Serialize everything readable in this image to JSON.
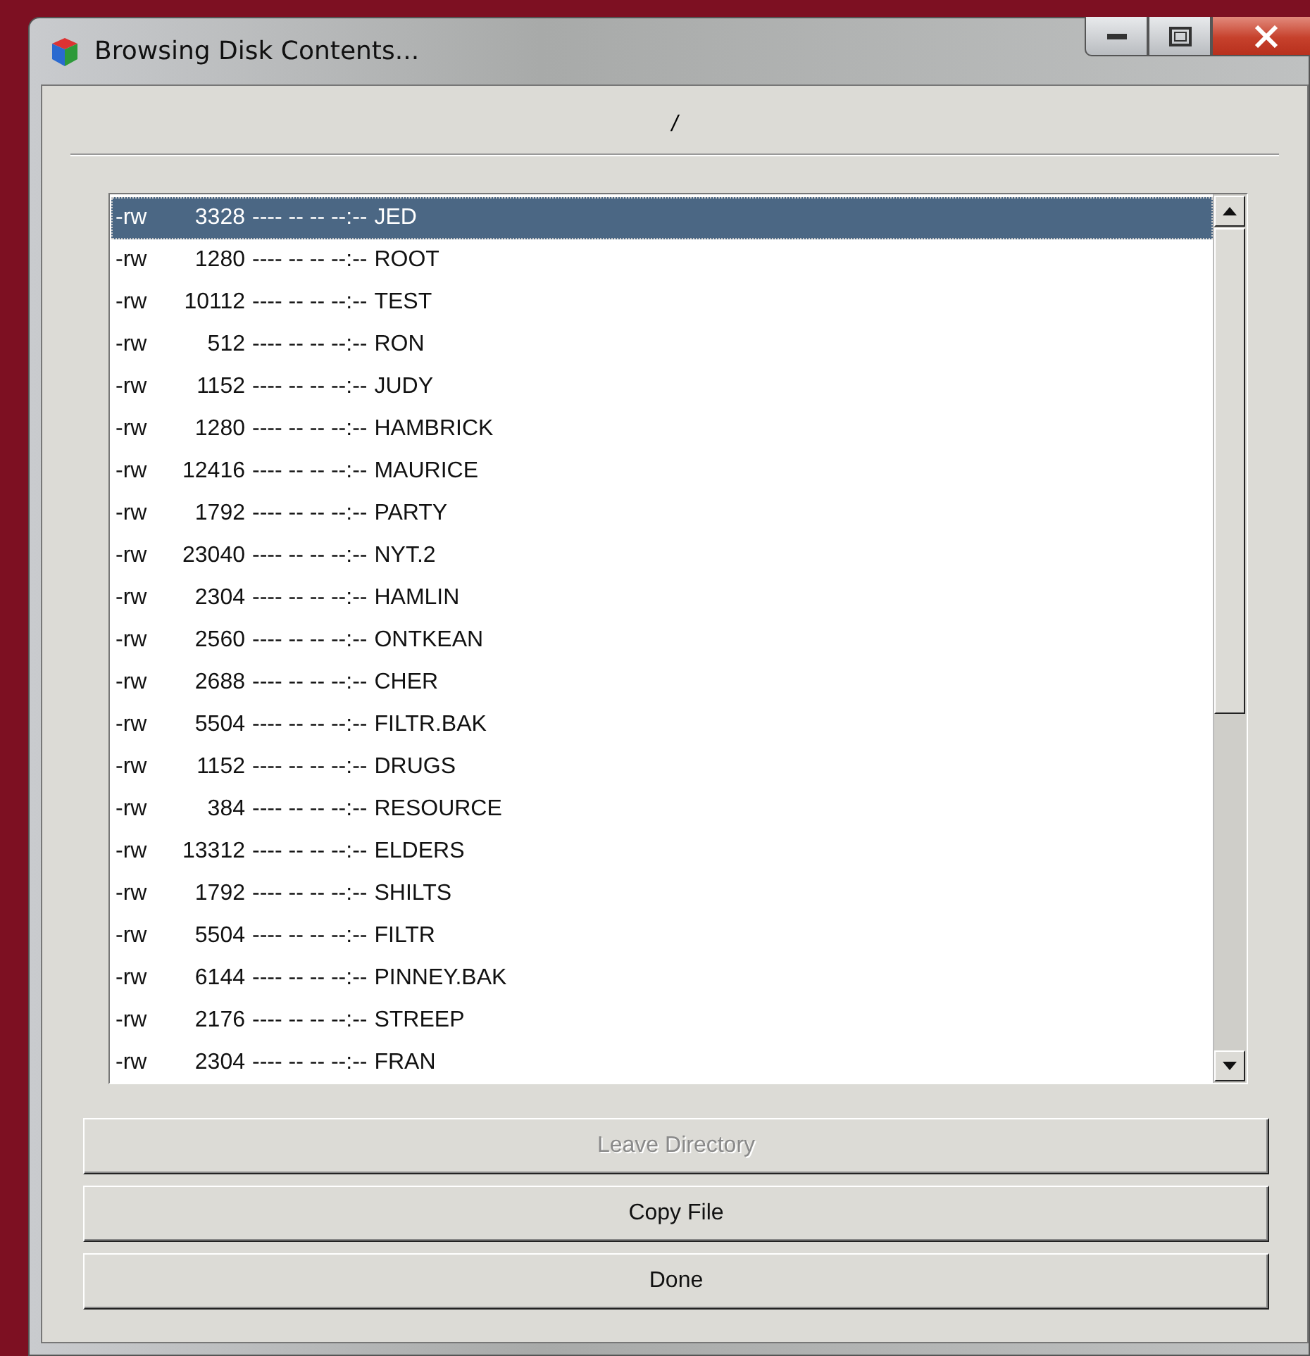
{
  "window": {
    "title": "Browsing Disk Contents..."
  },
  "path": "/",
  "files": [
    {
      "perm": "-rw",
      "size": "3328",
      "date": "---- -- -- --:--",
      "name": "JED",
      "selected": true
    },
    {
      "perm": "-rw",
      "size": "1280",
      "date": "---- -- -- --:--",
      "name": "ROOT",
      "selected": false
    },
    {
      "perm": "-rw",
      "size": "10112",
      "date": "---- -- -- --:--",
      "name": "TEST",
      "selected": false
    },
    {
      "perm": "-rw",
      "size": "512",
      "date": "---- -- -- --:--",
      "name": "RON",
      "selected": false
    },
    {
      "perm": "-rw",
      "size": "1152",
      "date": "---- -- -- --:--",
      "name": "JUDY",
      "selected": false
    },
    {
      "perm": "-rw",
      "size": "1280",
      "date": "---- -- -- --:--",
      "name": "HAMBRICK",
      "selected": false
    },
    {
      "perm": "-rw",
      "size": "12416",
      "date": "---- -- -- --:--",
      "name": "MAURICE",
      "selected": false
    },
    {
      "perm": "-rw",
      "size": "1792",
      "date": "---- -- -- --:--",
      "name": "PARTY",
      "selected": false
    },
    {
      "perm": "-rw",
      "size": "23040",
      "date": "---- -- -- --:--",
      "name": "NYT.2",
      "selected": false
    },
    {
      "perm": "-rw",
      "size": "2304",
      "date": "---- -- -- --:--",
      "name": "HAMLIN",
      "selected": false
    },
    {
      "perm": "-rw",
      "size": "2560",
      "date": "---- -- -- --:--",
      "name": "ONTKEAN",
      "selected": false
    },
    {
      "perm": "-rw",
      "size": "2688",
      "date": "---- -- -- --:--",
      "name": "CHER",
      "selected": false
    },
    {
      "perm": "-rw",
      "size": "5504",
      "date": "---- -- -- --:--",
      "name": "FILTR.BAK",
      "selected": false
    },
    {
      "perm": "-rw",
      "size": "1152",
      "date": "---- -- -- --:--",
      "name": "DRUGS",
      "selected": false
    },
    {
      "perm": "-rw",
      "size": "384",
      "date": "---- -- -- --:--",
      "name": "RESOURCE",
      "selected": false
    },
    {
      "perm": "-rw",
      "size": "13312",
      "date": "---- -- -- --:--",
      "name": "ELDERS",
      "selected": false
    },
    {
      "perm": "-rw",
      "size": "1792",
      "date": "---- -- -- --:--",
      "name": "SHILTS",
      "selected": false
    },
    {
      "perm": "-rw",
      "size": "5504",
      "date": "---- -- -- --:--",
      "name": "FILTR",
      "selected": false
    },
    {
      "perm": "-rw",
      "size": "6144",
      "date": "---- -- -- --:--",
      "name": "PINNEY.BAK",
      "selected": false
    },
    {
      "perm": "-rw",
      "size": "2176",
      "date": "---- -- -- --:--",
      "name": "STREEP",
      "selected": false
    },
    {
      "perm": "-rw",
      "size": "2304",
      "date": "---- -- -- --:--",
      "name": "FRAN",
      "selected": false
    }
  ],
  "buttons": [
    {
      "label": "Leave Directory",
      "disabled": true
    },
    {
      "label": "Copy File",
      "disabled": false
    },
    {
      "label": "Done",
      "disabled": false
    }
  ]
}
